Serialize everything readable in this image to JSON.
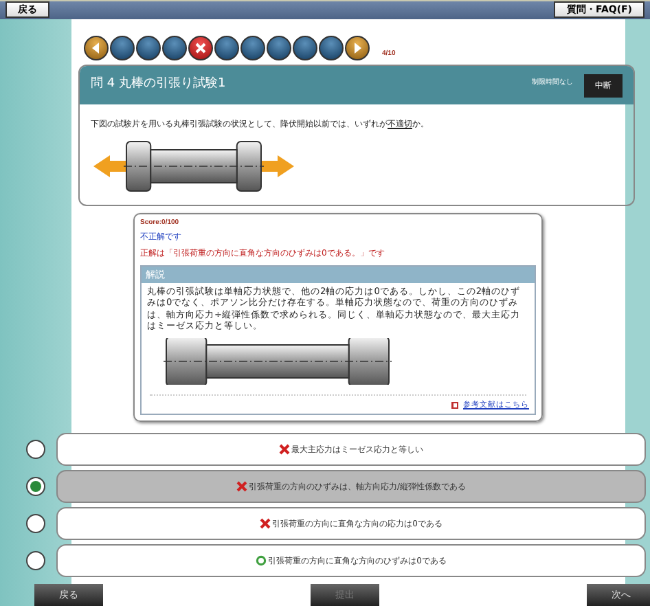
{
  "top_bar": {
    "back_button": "戻る",
    "help_button": "質問・FAQ(F)"
  },
  "nav": {
    "dots": [
      {
        "kind": "prev"
      },
      {
        "kind": "normal"
      },
      {
        "kind": "normal"
      },
      {
        "kind": "normal"
      },
      {
        "kind": "wrong"
      },
      {
        "kind": "normal"
      },
      {
        "kind": "normal"
      },
      {
        "kind": "normal"
      },
      {
        "kind": "normal"
      },
      {
        "kind": "normal"
      },
      {
        "kind": "next"
      }
    ],
    "progress": "4/10"
  },
  "question": {
    "title": "問 4  丸棒の引張り試験1",
    "time_limit": "制限時間なし",
    "suspend_button": "中断",
    "text": "下図の試験片を用いる丸棒引張試験の状況として、降伏開始以前では、いずれが**不適切**か。"
  },
  "feedback": {
    "score": "Score:0/100",
    "verdict": "不正解です",
    "correct_answer": "正解は「引張荷重の方向に直角な方向のひずみは0である。」です",
    "explanation_title": "解説",
    "explanation": "丸棒の引張試験は単軸応力状態で、他の2軸の応力は0である。しかし、この2軸のひずみは0でなく、ポアソン比分だけ存在する。単軸応力状態なので、荷重の方向のひずみは、軸方向応力÷縦弾性係数で求められる。同じく、単軸応力状態なので、最大主応力はミーゼス応力と等しい。",
    "reference_link": "参考文献はこちら"
  },
  "options": [
    {
      "text": "最大主応力はミーゼス応力と等しい",
      "correct": false,
      "selected": false
    },
    {
      "text": "引張荷重の方向のひずみは、軸方向応力/縦弾性係数である",
      "correct": false,
      "selected": true
    },
    {
      "text": "引張荷重の方向に直角な方向の応力は0である",
      "correct": false,
      "selected": false
    },
    {
      "text": "引張荷重の方向に直角な方向のひずみは0である",
      "correct": true,
      "selected": false
    }
  ],
  "bottom_bar": [
    {
      "label": "戻る",
      "disabled": false
    },
    {
      "label": "提出",
      "disabled": true
    },
    {
      "label": "次へ",
      "disabled": false
    }
  ]
}
